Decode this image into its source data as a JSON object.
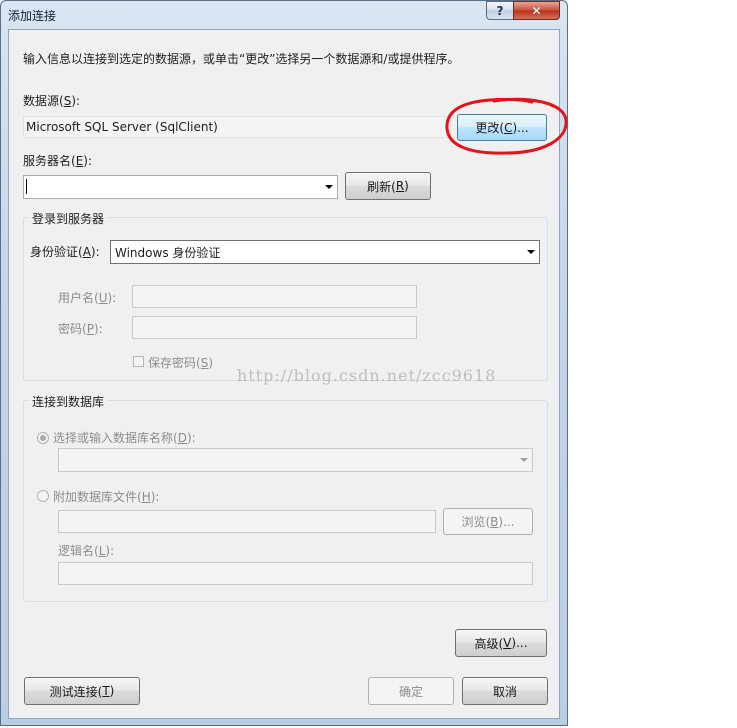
{
  "window": {
    "title": "添加连接",
    "help_glyph": "?",
    "close_glyph": "✕"
  },
  "intro_text": "输入信息以连接到选定的数据源，或单击“更改”选择另一个数据源和/或提供程序。",
  "data_source": {
    "label": "数据源(",
    "hotkey": "S",
    "label_end": "):",
    "value": "Microsoft SQL Server (SqlClient)",
    "change_button": {
      "text": "更改(",
      "hotkey": "C",
      "text_end": ")..."
    }
  },
  "server": {
    "label": "服务器名(",
    "hotkey": "E",
    "label_end": "):",
    "value": "",
    "refresh_button": {
      "text": "刷新(",
      "hotkey": "R",
      "text_end": ")"
    }
  },
  "login_group": {
    "title": "登录到服务器",
    "auth_label": "身份验证(",
    "auth_hotkey": "A",
    "auth_label_end": "):",
    "auth_value": "Windows 身份验证",
    "username_label": "用户名(",
    "username_hotkey": "U",
    "username_label_end": "):",
    "password_label": "密码(",
    "password_hotkey": "P",
    "password_label_end": "):",
    "save_password_label": "保存密码(",
    "save_password_hotkey": "S",
    "save_password_label_end": ")",
    "save_password_checked": false
  },
  "database_group": {
    "title": "连接到数据库",
    "select_db_label": "选择或输入数据库名称(",
    "select_db_hotkey": "D",
    "select_db_label_end": "):",
    "select_db_checked": true,
    "attach_label": "附加数据库文件(",
    "attach_hotkey": "H",
    "attach_label_end": "):",
    "attach_checked": false,
    "browse_button": {
      "text": "浏览(",
      "hotkey": "B",
      "text_end": ")..."
    },
    "logical_name_label": "逻辑名(",
    "logical_name_hotkey": "L",
    "logical_name_label_end": "):"
  },
  "advanced_button": {
    "text": "高级(",
    "hotkey": "V",
    "text_end": ")..."
  },
  "test_button": {
    "text": "测试连接(",
    "hotkey": "T",
    "text_end": ")"
  },
  "ok_button": {
    "text": "确定"
  },
  "cancel_button": {
    "text": "取消"
  },
  "watermark": "http://blog.csdn.net/zcc9618",
  "colors": {
    "annotation": "#e0141a",
    "focus_border": "#3c7fb1"
  }
}
